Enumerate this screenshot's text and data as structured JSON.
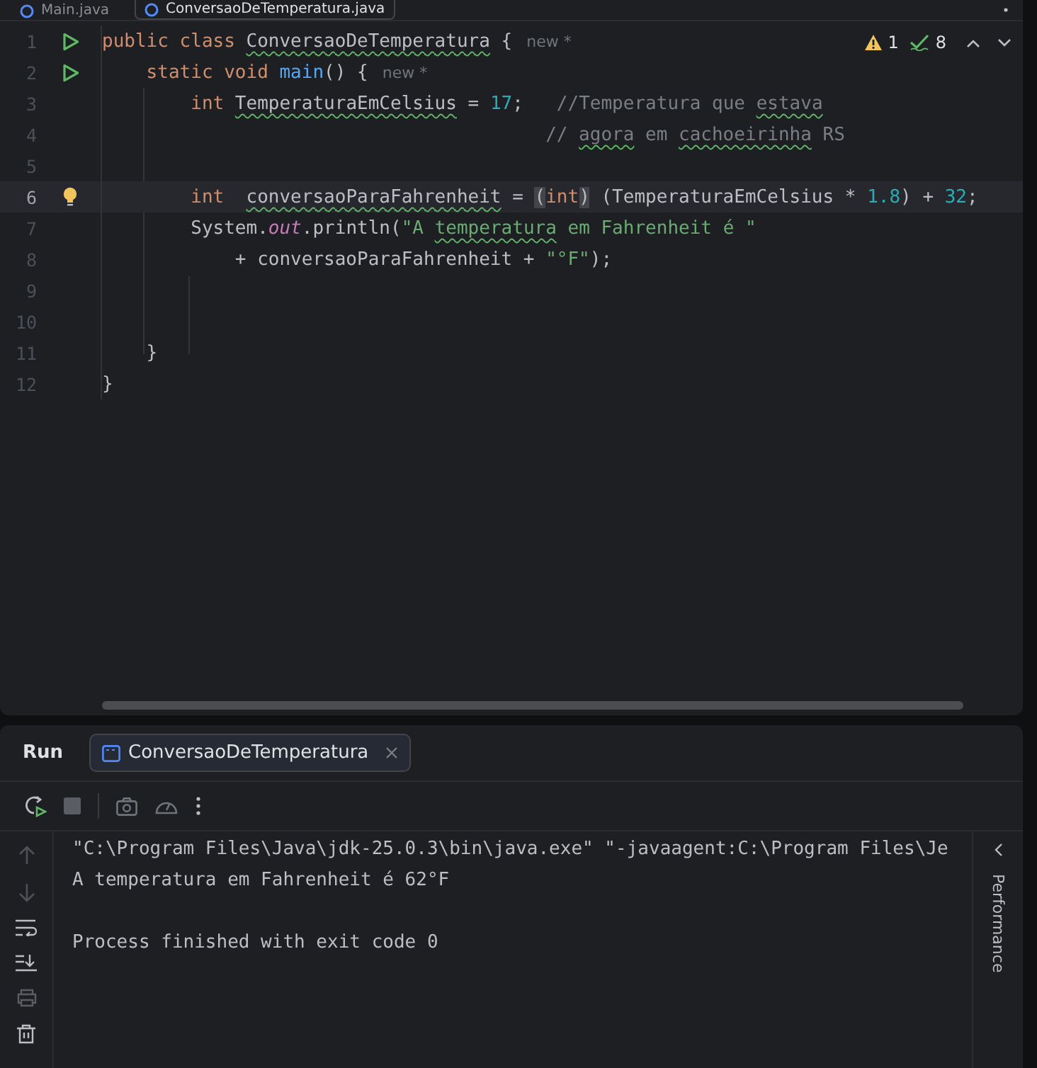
{
  "editor_tabs": [
    {
      "label": "Main.java",
      "selected": false
    },
    {
      "label": "ConversaoDeTemperatura.java",
      "selected": true
    }
  ],
  "inspection": {
    "warnings": "1",
    "checks": "8"
  },
  "code_lines": [
    {
      "number": "1",
      "run_icon": true,
      "hint": "new *",
      "tokens": [
        {
          "kind": "kw",
          "t": "public class "
        },
        {
          "kind": "plain",
          "t": "ConversaoDeTemperatura",
          "warn": true
        },
        {
          "kind": "plain",
          "t": " {"
        }
      ]
    },
    {
      "number": "2",
      "run_icon": true,
      "hint": "new *",
      "tokens": [
        {
          "kind": "kw",
          "t": "    static void "
        },
        {
          "kind": "fn",
          "t": "main"
        },
        {
          "kind": "plain",
          "t": "() {"
        }
      ]
    },
    {
      "number": "3",
      "tokens": [
        {
          "kind": "kw",
          "t": "        int "
        },
        {
          "kind": "plain",
          "t": "TemperaturaEmCelsius",
          "warn": true
        },
        {
          "kind": "plain",
          "t": " = "
        },
        {
          "kind": "num",
          "t": "17"
        },
        {
          "kind": "plain",
          "t": ";   "
        },
        {
          "kind": "cmt",
          "t": "//Temperatura que "
        },
        {
          "kind": "cmt",
          "t": "estava",
          "warn": true
        }
      ]
    },
    {
      "number": "4",
      "tokens": [
        {
          "kind": "cmt",
          "t": "                                        // "
        },
        {
          "kind": "cmt",
          "t": "agora",
          "warn": true
        },
        {
          "kind": "cmt",
          "t": " em "
        },
        {
          "kind": "cmt",
          "t": "cachoeirinha",
          "warn": true
        },
        {
          "kind": "cmt",
          "t": " RS"
        }
      ]
    },
    {
      "number": "5"
    },
    {
      "number": "6",
      "current": true,
      "bulb": true,
      "tokens": [
        {
          "kind": "kw",
          "t": "        int  "
        },
        {
          "kind": "plain",
          "t": "conversaoParaFahrenheit",
          "warn": true
        },
        {
          "kind": "plain",
          "t": " = "
        },
        {
          "kind": "plain",
          "t": "(",
          "matched": true
        },
        {
          "kind": "kw",
          "t": "int"
        },
        {
          "kind": "plain",
          "t": ")",
          "matched": true
        },
        {
          "kind": "plain",
          "t": " (TemperaturaEmCelsius * "
        },
        {
          "kind": "num",
          "t": "1.8"
        },
        {
          "kind": "plain",
          "t": ") + "
        },
        {
          "kind": "num",
          "t": "32"
        },
        {
          "kind": "plain",
          "t": ";"
        }
      ]
    },
    {
      "number": "7",
      "tokens": [
        {
          "kind": "plain",
          "t": "        System."
        },
        {
          "kind": "field",
          "t": "out"
        },
        {
          "kind": "plain",
          "t": ".println("
        },
        {
          "kind": "str",
          "t": "\"A "
        },
        {
          "kind": "str",
          "t": "temperatura",
          "warn": true
        },
        {
          "kind": "str",
          "t": " em Fahrenheit é \""
        }
      ]
    },
    {
      "number": "8",
      "tokens": [
        {
          "kind": "plain",
          "t": "            + conversaoParaFahrenheit + "
        },
        {
          "kind": "str",
          "t": "\"°F\""
        },
        {
          "kind": "plain",
          "t": ");"
        }
      ]
    },
    {
      "number": "9"
    },
    {
      "number": "10"
    },
    {
      "number": "11",
      "tokens": [
        {
          "kind": "plain",
          "t": "    }"
        }
      ]
    },
    {
      "number": "12",
      "tokens": [
        {
          "kind": "plain",
          "t": "}"
        }
      ]
    }
  ],
  "run_panel": {
    "title": "Run",
    "tab": {
      "label": "ConversaoDeTemperatura",
      "selected": true
    },
    "console": [
      {
        "text": "\"C:\\Program Files\\Java\\jdk-25.0.3\\bin\\java.exe\" \"-javaagent:C:\\Program Files\\Je"
      },
      {
        "text": "A temperatura em Fahrenheit é 62°F"
      },
      {
        "text": "Process finished with exit code 0",
        "gap_before": true
      }
    ],
    "side_tab": "Performance"
  }
}
